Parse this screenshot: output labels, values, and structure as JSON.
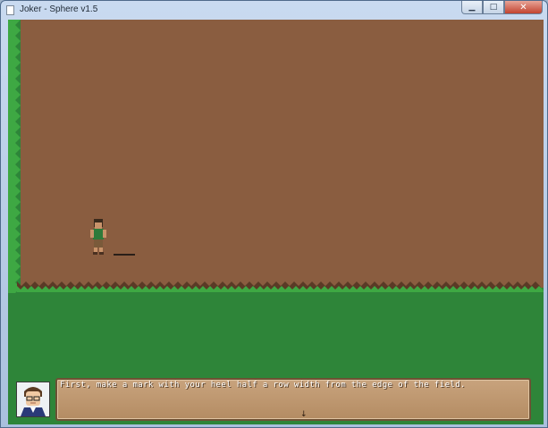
{
  "window": {
    "title": "Joker - Sphere v1.5",
    "controls": {
      "minimize": "▁",
      "maximize": "□",
      "close": "✕"
    }
  },
  "scene": {
    "colors": {
      "grass": "#2e8539",
      "dirt": "#8a5d40",
      "grass_fringe": "#3ea843"
    },
    "player": "farmer-sprite"
  },
  "dialogue": {
    "text": "First, make a mark with your heel half a row width from the edge of the field.",
    "more_indicator": "↓"
  },
  "colors": {
    "textbox": "#c8a37d",
    "textbox_border": "#6d5134"
  }
}
